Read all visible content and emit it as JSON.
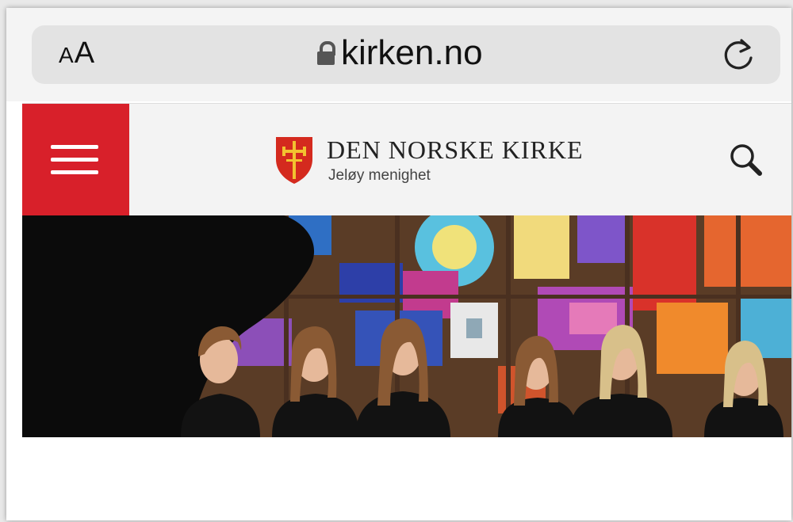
{
  "browser": {
    "text_size_label_small": "A",
    "text_size_label_large": "A",
    "url": "kirken.no"
  },
  "site": {
    "brand_name": "DEN NORSKE KIRKE",
    "parish": "Jeløy menighet"
  },
  "colors": {
    "menu_red": "#d8202a",
    "logo_red": "#d42a1e",
    "logo_gold": "#f2c230"
  },
  "icons": {
    "lock": "lock-icon",
    "reload": "reload-icon",
    "menu": "hamburger-menu-icon",
    "search": "search-icon",
    "logo": "church-cross-shield-icon"
  }
}
